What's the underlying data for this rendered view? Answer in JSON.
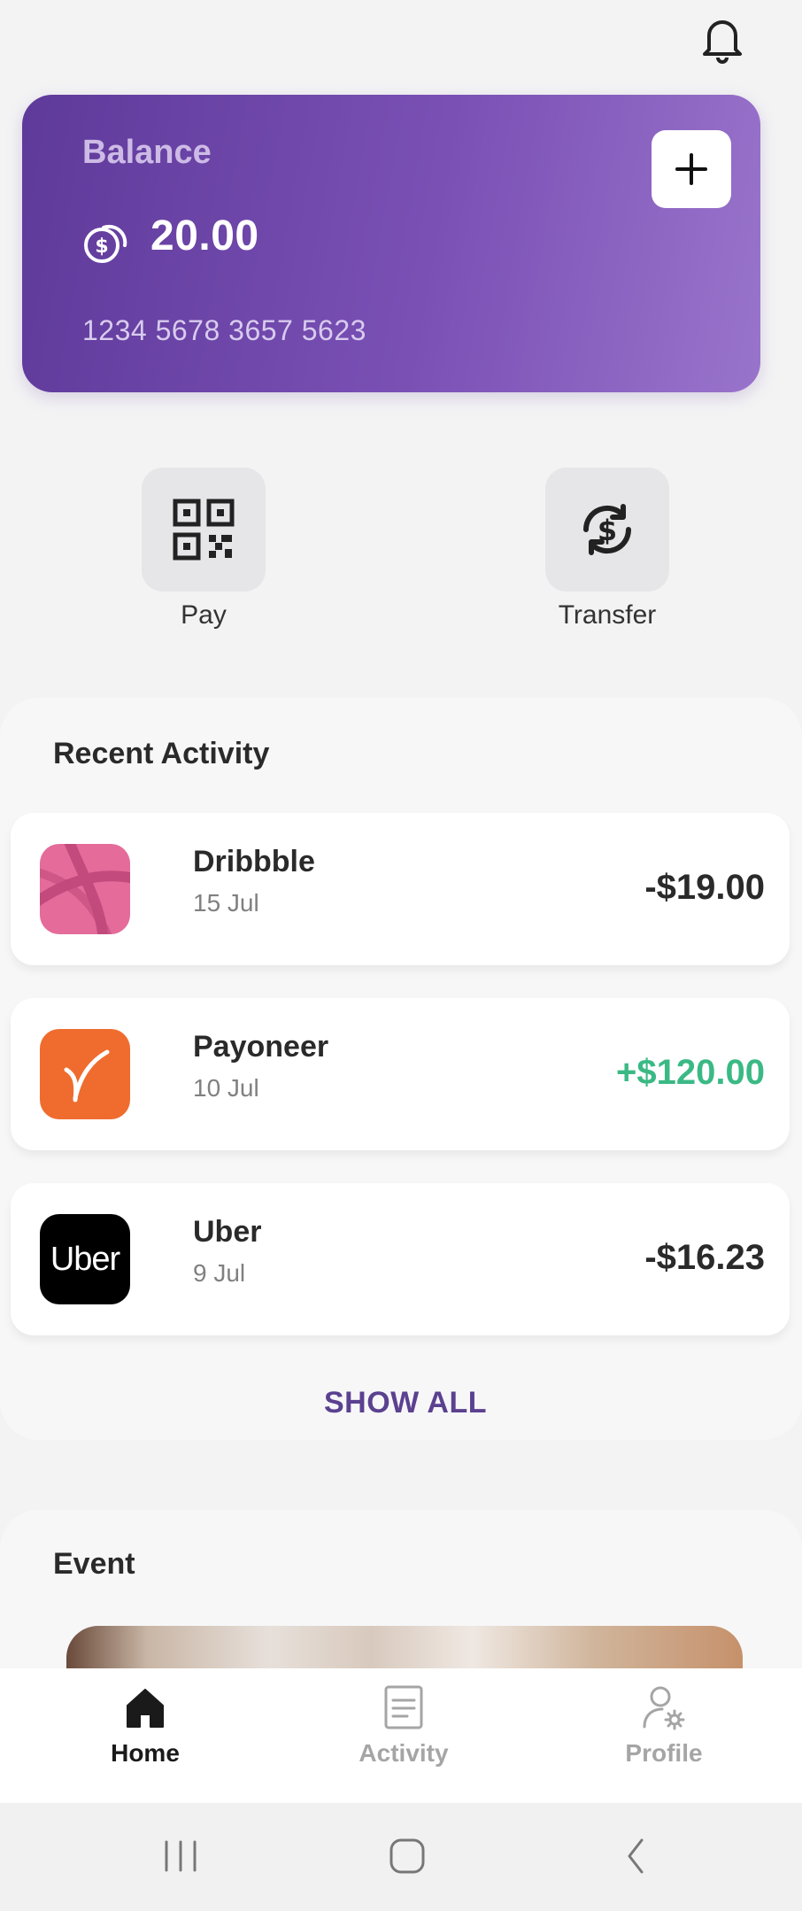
{
  "header": {
    "bell_icon": "bell-icon"
  },
  "card": {
    "label": "Balance",
    "balance": "20.00",
    "card_number": "1234 5678 3657 5623",
    "coin_icon": "dollar-coins-icon",
    "add_icon": "plus-icon",
    "gradient": [
      "#5e3a9a",
      "#9974cb"
    ]
  },
  "actions": [
    {
      "label": "Pay",
      "icon": "qr-code-icon"
    },
    {
      "label": "Transfer",
      "icon": "dollar-exchange-icon"
    }
  ],
  "recent_activity": {
    "title": "Recent Activity",
    "items": [
      {
        "name": "Dribbble",
        "date": "15 Jul",
        "amount": "-$19.00",
        "logo": "dribbble-logo",
        "logo_color": "#e46b9a"
      },
      {
        "name": "Payoneer",
        "date": "10 Jul",
        "amount": "+$120.00",
        "logo": "payoneer-logo",
        "logo_color": "#ef6c2e"
      },
      {
        "name": "Uber",
        "date": "9 Jul",
        "amount": "-$16.23",
        "logo": "uber-logo",
        "logo_text": "Uber",
        "logo_color": "#000000"
      }
    ],
    "show_all": "SHOW ALL",
    "positive_color": "#3bb985"
  },
  "event": {
    "title": "Event"
  },
  "bottom_nav": [
    {
      "label": "Home",
      "icon": "home-icon",
      "active": true
    },
    {
      "label": "Activity",
      "icon": "document-icon",
      "active": false
    },
    {
      "label": "Profile",
      "icon": "user-settings-icon",
      "active": false
    }
  ],
  "system_nav": [
    "recent-apps-icon",
    "home-circle-icon",
    "back-icon"
  ]
}
